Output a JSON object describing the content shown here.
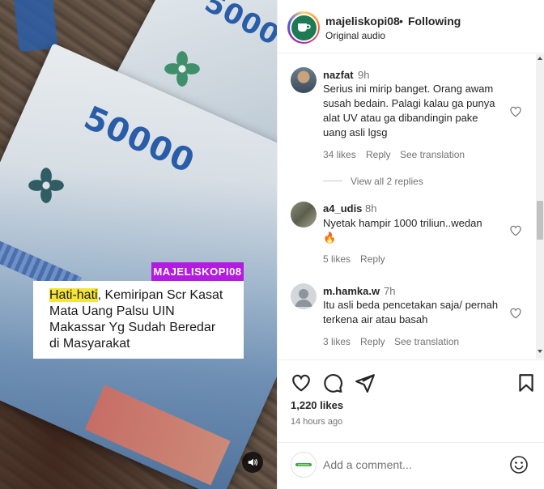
{
  "media": {
    "brand_tag": "MAJELISKOPI08",
    "caption_highlight": "Hati-hati",
    "caption_rest": ", Kemiripan Scr Kasat Mata Uang Palsu UIN Makassar Yg Sudah Beredar di Masyarakat",
    "denomination_front": "50000",
    "denomination_back": "5000",
    "sound_icon": "speaker-icon"
  },
  "header": {
    "username": "majeliskopi08",
    "separator": "•",
    "follow_status": "Following",
    "audio_label": "Original audio"
  },
  "comments": [
    {
      "username": "nazfat",
      "time": "9h",
      "text": "Serius ini mirip banget. Orang awam susah bedain. Palagi kalau ga punya alat UV atau ga dibandingin pake uang asli lgsg",
      "likes": "34 likes",
      "reply": "Reply",
      "translate": "See translation"
    },
    {
      "username": "a4_udis",
      "time": "8h",
      "text": "Nyetak hampir 1000 triliun..wedan",
      "emoji": "🔥",
      "likes": "5 likes",
      "reply": "Reply"
    },
    {
      "username": "m.hamka.w",
      "time": "7h",
      "text": "Itu asli beda pencetakan saja/ pernah terkena air atau basah",
      "likes": "3 likes",
      "reply": "Reply",
      "translate": "See translation"
    }
  ],
  "view_replies": "View all 2 replies",
  "actions": {
    "likes": "1,220 likes",
    "time_ago": "14 hours ago",
    "icons": [
      "heart-icon",
      "comment-icon",
      "share-icon",
      "bookmark-icon"
    ]
  },
  "comment_bar": {
    "placeholder": "Add a comment..."
  },
  "colors": {
    "brand_tag_bg": "#b31ce0",
    "caption_highlight_bg": "#f4e53a",
    "secondary_text": "#737373"
  }
}
